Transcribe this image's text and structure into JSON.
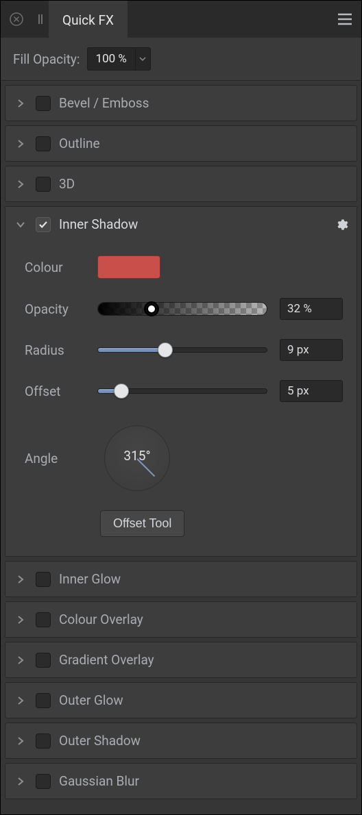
{
  "title": "Quick FX",
  "fill_opacity": {
    "label": "Fill Opacity:",
    "value": "100 %"
  },
  "sections": {
    "bevel": {
      "label": "Bevel / Emboss",
      "checked": false,
      "expanded": false
    },
    "outline": {
      "label": "Outline",
      "checked": false,
      "expanded": false
    },
    "threeD": {
      "label": "3D",
      "checked": false,
      "expanded": false
    },
    "inner_shadow": {
      "label": "Inner Shadow",
      "checked": true,
      "expanded": true,
      "colour_label": "Colour",
      "colour": "#c94f4b",
      "opacity_label": "Opacity",
      "opacity_value": "32 %",
      "opacity_percent": 32,
      "radius_label": "Radius",
      "radius_value": "9 px",
      "radius_percent": 40,
      "offset_label": "Offset",
      "offset_value": "5 px",
      "offset_percent": 14,
      "angle_label": "Angle",
      "angle_value": "315°",
      "offset_tool": "Offset Tool"
    },
    "inner_glow": {
      "label": "Inner Glow",
      "checked": false,
      "expanded": false
    },
    "colour_overlay": {
      "label": "Colour Overlay",
      "checked": false,
      "expanded": false
    },
    "gradient_overlay": {
      "label": "Gradient Overlay",
      "checked": false,
      "expanded": false
    },
    "outer_glow": {
      "label": "Outer Glow",
      "checked": false,
      "expanded": false
    },
    "outer_shadow": {
      "label": "Outer Shadow",
      "checked": false,
      "expanded": false
    },
    "gaussian_blur": {
      "label": "Gaussian Blur",
      "checked": false,
      "expanded": false
    }
  }
}
